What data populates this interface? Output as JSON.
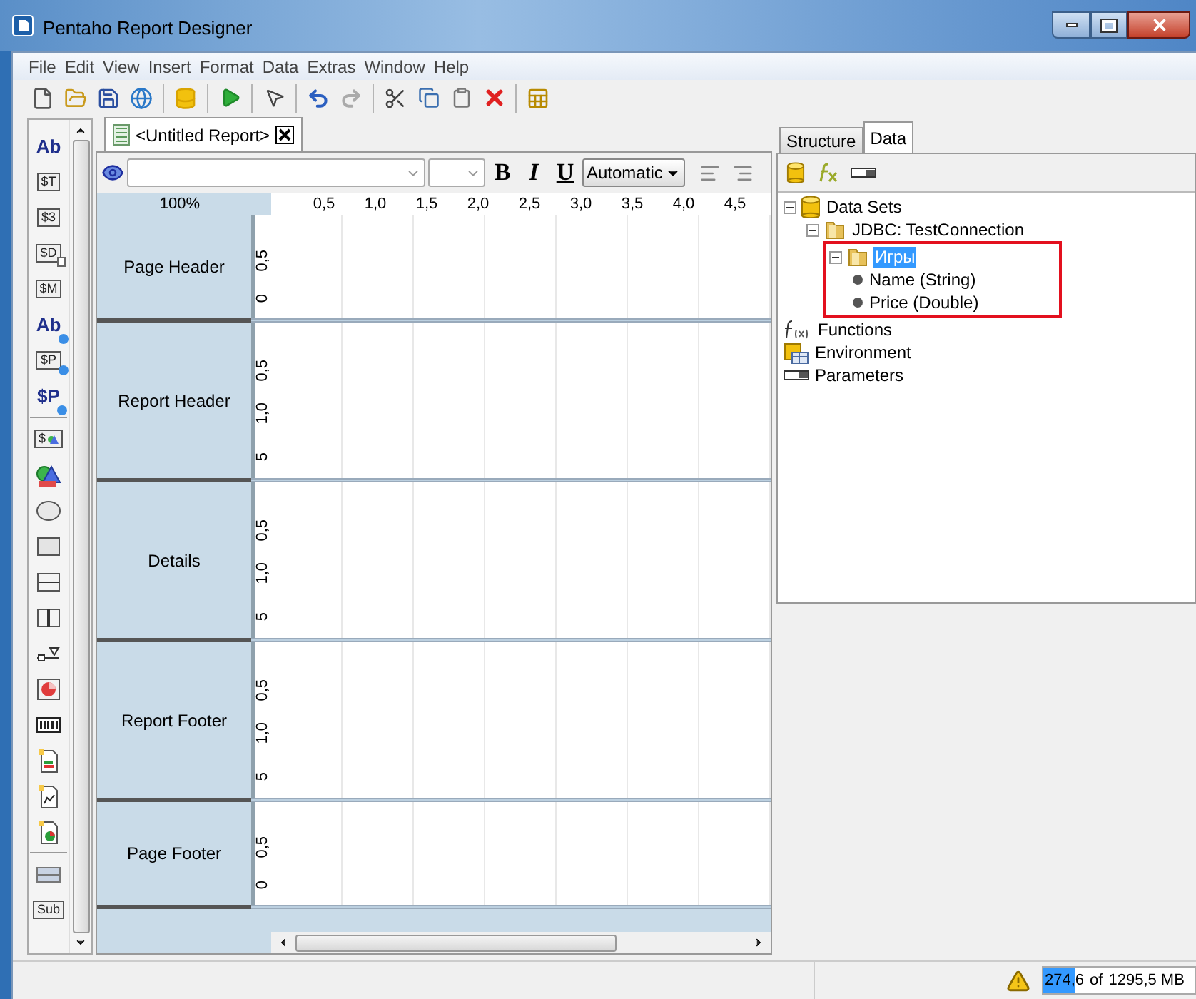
{
  "window": {
    "title": "Pentaho Report Designer"
  },
  "menu": [
    "File",
    "Edit",
    "View",
    "Insert",
    "Format",
    "Data",
    "Extras",
    "Window",
    "Help"
  ],
  "palette": [
    {
      "kind": "plain",
      "label": "Ab"
    },
    {
      "kind": "boxed",
      "label": "$T"
    },
    {
      "kind": "boxed",
      "label": "$3"
    },
    {
      "kind": "boxed-page",
      "label": "$D"
    },
    {
      "kind": "boxed",
      "label": "$M"
    },
    {
      "kind": "plain-globe",
      "label": "Ab"
    },
    {
      "kind": "boxed-globe",
      "label": "$P"
    },
    {
      "kind": "plain-globe",
      "label": "$P"
    },
    {
      "kind": "separator"
    },
    {
      "kind": "boxed-shapes",
      "label": "$"
    },
    {
      "kind": "shapes"
    },
    {
      "kind": "ellipse"
    },
    {
      "kind": "rectangle"
    },
    {
      "kind": "hline"
    },
    {
      "kind": "vline"
    },
    {
      "kind": "scale"
    },
    {
      "kind": "pie"
    },
    {
      "kind": "barcode"
    },
    {
      "kind": "doc-bars"
    },
    {
      "kind": "doc-line"
    },
    {
      "kind": "doc-pie"
    },
    {
      "kind": "separator"
    },
    {
      "kind": "band"
    },
    {
      "kind": "boxed",
      "label": "Sub"
    }
  ],
  "editor": {
    "tab": "<Untitled Report>",
    "format_bar": {
      "bold": "B",
      "italic": "I",
      "underline": "U",
      "color_option": "Automatic"
    },
    "zoom": "100%",
    "ruler": [
      "0,5",
      "1,0",
      "1,5",
      "2,0",
      "2,5",
      "3,0",
      "3,5",
      "4,0",
      "4,5"
    ],
    "bands": [
      {
        "name": "Page Header",
        "ruler": [
          "0,5",
          "0"
        ]
      },
      {
        "name": "Report Header",
        "ruler": [
          "0,5",
          "1,0",
          "5"
        ]
      },
      {
        "name": "Details",
        "ruler": [
          "0,5",
          "1,0",
          "5"
        ]
      },
      {
        "name": "Report Footer",
        "ruler": [
          "0,5",
          "1,0",
          "5"
        ]
      },
      {
        "name": "Page Footer",
        "ruler": [
          "0,5",
          "0"
        ]
      }
    ]
  },
  "side_panel": {
    "tabs": [
      {
        "label": "Structure",
        "selected": false
      },
      {
        "label": "Data",
        "selected": true
      }
    ],
    "tree": [
      {
        "label": "Data Sets",
        "kind": "database",
        "expanded": true,
        "selected": false,
        "children": [
          {
            "label": "JDBC: TestConnection",
            "kind": "folder",
            "expanded": true,
            "selected": false,
            "children": [
              {
                "label": "Игры",
                "kind": "folder",
                "expanded": true,
                "selected": true,
                "highlighted": true,
                "children": [
                  {
                    "label": "Name (String)",
                    "kind": "field",
                    "selected": false
                  },
                  {
                    "label": "Price (Double)",
                    "kind": "field",
                    "selected": false
                  }
                ]
              }
            ]
          }
        ]
      },
      {
        "label": "Functions",
        "kind": "function",
        "selected": false
      },
      {
        "label": "Environment",
        "kind": "environment",
        "selected": false
      },
      {
        "label": "Parameters",
        "kind": "parameter",
        "selected": false
      }
    ]
  },
  "status_bar": {
    "memory": {
      "used": "274,6",
      "of": "of",
      "total": "1295,5 MB",
      "level": 0.21
    }
  }
}
